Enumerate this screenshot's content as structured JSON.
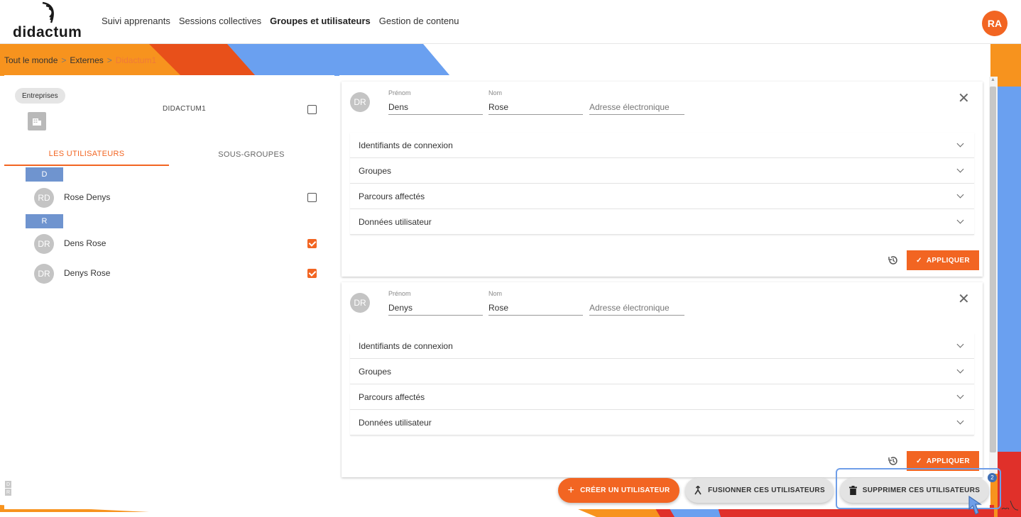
{
  "app": {
    "logo_text": "didactum",
    "user_initials": "RA"
  },
  "nav": {
    "items": [
      {
        "label": "Suivi apprenants",
        "active": false
      },
      {
        "label": "Sessions collectives",
        "active": false
      },
      {
        "label": "Groupes et utilisateurs",
        "active": true
      },
      {
        "label": "Gestion de contenu",
        "active": false
      }
    ]
  },
  "breadcrumb": {
    "items": [
      "Tout le monde",
      "Externes",
      "Didactum1"
    ],
    "separator": ">"
  },
  "left_panel": {
    "chip_label": "Entreprises",
    "company_icon": "building-icon",
    "company_name": "DIDACTUM1",
    "company_checked": false,
    "tabs": [
      {
        "label": "LES UTILISATEURS",
        "active": true
      },
      {
        "label": "SOUS-GROUPES",
        "active": false
      }
    ],
    "groups": [
      {
        "letter": "D",
        "users": [
          {
            "initials": "RD",
            "name": "Rose Denys",
            "checked": false
          }
        ]
      },
      {
        "letter": "R",
        "users": [
          {
            "initials": "DR",
            "name": "Dens Rose",
            "checked": true
          },
          {
            "initials": "DR",
            "name": "Denys Rose",
            "checked": true
          }
        ]
      }
    ],
    "mini_letters": [
      "D",
      "R"
    ]
  },
  "cards": [
    {
      "initials": "DR",
      "first_name_label": "Prénom",
      "first_name": "Dens",
      "last_name_label": "Nom",
      "last_name": "Rose",
      "email_placeholder": "Adresse électronique",
      "sections": [
        "Identifiants de connexion",
        "Groupes",
        "Parcours affectés",
        "Données utilisateur"
      ],
      "apply_label": "APPLIQUER"
    },
    {
      "initials": "DR",
      "first_name_label": "Prénom",
      "first_name": "Denys",
      "last_name_label": "Nom",
      "last_name": "Rose",
      "email_placeholder": "Adresse électronique",
      "sections": [
        "Identifiants de connexion",
        "Groupes",
        "Parcours affectés",
        "Données utilisateur"
      ],
      "apply_label": "APPLIQUER"
    }
  ],
  "actions": {
    "create_label": "CRÉER UN UTILISATEUR",
    "merge_label": "FUSIONNER CES UTILISATEURS",
    "delete_label": "SUPPRIMER CES UTILISATEURS",
    "selected_count": "2"
  },
  "colors": {
    "accent": "#f26522",
    "letter_header": "#6f94cf",
    "highlight": "#6f9ee8",
    "deco_orange": "#f7931e",
    "deco_red_orange": "#e8501a",
    "deco_blue": "#6aa0f0"
  }
}
